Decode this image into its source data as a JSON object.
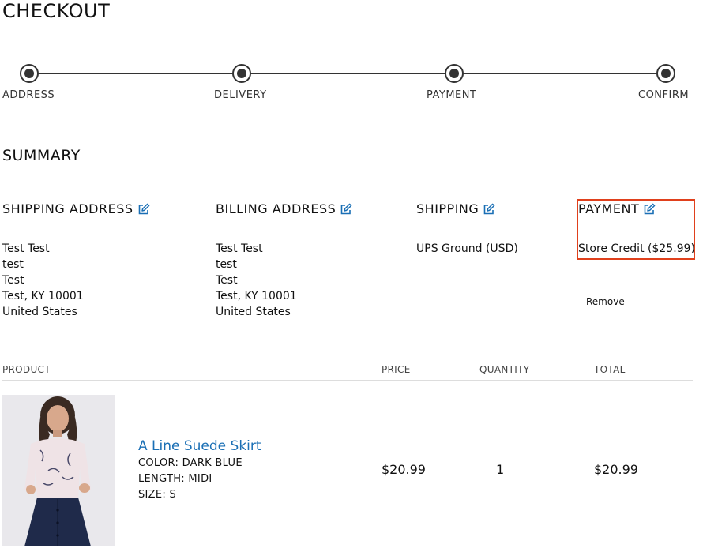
{
  "page": {
    "title": "CHECKOUT"
  },
  "stepper": {
    "steps": [
      {
        "label": "ADDRESS"
      },
      {
        "label": "DELIVERY"
      },
      {
        "label": "PAYMENT"
      },
      {
        "label": "CONFIRM"
      }
    ]
  },
  "summary": {
    "title": "SUMMARY",
    "shipping_address": {
      "heading": "SHIPPING ADDRESS",
      "lines": [
        "Test Test",
        "test",
        "Test",
        "Test, KY 10001",
        "United States"
      ]
    },
    "billing_address": {
      "heading": "BILLING ADDRESS",
      "lines": [
        "Test Test",
        "test",
        "Test",
        "Test, KY 10001",
        "United States"
      ]
    },
    "shipping": {
      "heading": "SHIPPING",
      "method": "UPS Ground (USD)"
    },
    "payment": {
      "heading": "PAYMENT",
      "method": "Store Credit ($25.99)",
      "remove_label": "Remove"
    }
  },
  "table": {
    "headers": {
      "product": "PRODUCT",
      "price": "PRICE",
      "quantity": "QUANTITY",
      "total": "TOTAL"
    },
    "rows": [
      {
        "name": "A Line Suede Skirt",
        "color": "COLOR: DARK BLUE",
        "length": "LENGTH: MIDI",
        "size": "SIZE: S",
        "price": "$20.99",
        "quantity": "1",
        "total": "$20.99"
      }
    ]
  },
  "colors": {
    "accent_link": "#1a6fb5",
    "highlight_border": "#e0401c",
    "stepper": "#333333"
  }
}
